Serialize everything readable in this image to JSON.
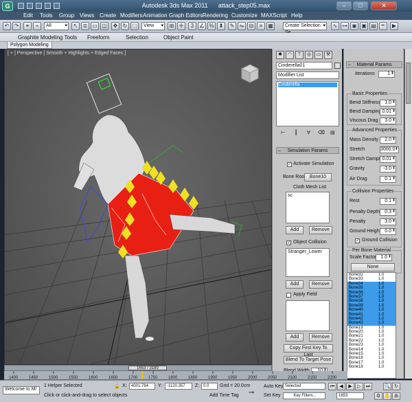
{
  "window": {
    "title_app": "Autodesk 3ds Max  2011",
    "title_file": "attack_step05.max",
    "minimize": "–",
    "maximize": "□",
    "close": "✕"
  },
  "menu": [
    "Edit",
    "Tools",
    "Group",
    "Views",
    "Create",
    "Modifiers",
    "Animation",
    "Graph Editors",
    "Rendering",
    "Customize",
    "MAXScript",
    "Help"
  ],
  "toolbar": {
    "selection_filter": "All",
    "reference_coord": "View",
    "named_selection": "Create Selection Se"
  },
  "ribbon": {
    "tabs": [
      "Graphite Modeling Tools",
      "Freeform",
      "Selection",
      "Object Paint"
    ],
    "panel_tab": "Polygon Modeling"
  },
  "viewport": {
    "label": "[ + ] Perspective  [ Smooth + Highlights + Edged Faces ]"
  },
  "command_panel": {
    "object_name": "Cinderella01",
    "modifier_list": "Modifier List",
    "stack_items": [
      "Cinderella"
    ],
    "simulation": {
      "header": "Simulation Params",
      "activate_label": "Activate Simulation",
      "activate_checked": true,
      "bone_root_label": "Bone Root",
      "bone_root_value": "Bone10",
      "cloth_mesh_label": "Cloth Mesh List",
      "cloth_mesh_items": [
        "sc"
      ],
      "add": "Add",
      "remove": "Remove",
      "object_collision_label": "Object Collision",
      "object_collision_checked": true,
      "collision_items": [
        "Stranger_Lower"
      ],
      "apply_field_label": "Apply Field",
      "apply_field_checked": false,
      "copy_first_key": "Copy First Key To Last",
      "blend_to_target": "Blend To Target Pose",
      "blend_width_label": "Blend Width",
      "blend_width_value": "10"
    }
  },
  "material_panel": {
    "header": "Material Params",
    "iterations_label": "Iterations",
    "iterations_value": "1",
    "basic_title": "Basic Properties",
    "basic": [
      {
        "label": "Bend Stiffness",
        "value": "1.0"
      },
      {
        "label": "Bend Damping",
        "value": "0.01"
      },
      {
        "label": "Viscous Drag",
        "value": "3.0"
      }
    ],
    "advanced_title": "Advanced Properties",
    "advanced": [
      {
        "label": "Mass Density",
        "value": "2.0"
      },
      {
        "label": "Stretch",
        "value": "3000.0"
      },
      {
        "label": "Stretch Damping",
        "value": "0.01"
      },
      {
        "label": "Gravity",
        "value": "-3.0"
      },
      {
        "label": "Air Drag",
        "value": "0.1"
      }
    ],
    "collision_title": "Collision Properties",
    "collision": [
      {
        "label": "Rest",
        "value": "0.1"
      },
      {
        "label": "Penalty Depth",
        "value": "0.3"
      },
      {
        "label": "Penalty",
        "value": "3.0"
      },
      {
        "label": "Ground Height",
        "value": "0.0"
      }
    ],
    "ground_collision_label": "Ground Collision",
    "ground_collision_checked": true,
    "per_bone_title": "Per Bone Material",
    "scale_factor_label": "Scale Factor",
    "scale_factor_value": "1.0",
    "none_button": "None",
    "bones": [
      {
        "name": "Bone32",
        "value": "1.0",
        "sel": false
      },
      {
        "name": "Bone33",
        "value": "1.0",
        "sel": false
      },
      {
        "name": "Bone34",
        "value": "1.0",
        "sel": true
      },
      {
        "name": "Bone35",
        "value": "1.0",
        "sel": true
      },
      {
        "name": "Bone36",
        "value": "1.0",
        "sel": true
      },
      {
        "name": "Bone37",
        "value": "1.0",
        "sel": true
      },
      {
        "name": "Bone38",
        "value": "1.0",
        "sel": true
      },
      {
        "name": "Bone39",
        "value": "1.0",
        "sel": true
      },
      {
        "name": "Bone40",
        "value": "1.0",
        "sel": true
      },
      {
        "name": "Bone41",
        "value": "1.0",
        "sel": true
      },
      {
        "name": "Bone42",
        "value": "1.0",
        "sel": true
      },
      {
        "name": "Bone43",
        "value": "1.0",
        "sel": true
      },
      {
        "name": "Bone19",
        "value": "1.0",
        "sel": false
      },
      {
        "name": "Bone20",
        "value": "1.0",
        "sel": false
      },
      {
        "name": "Bone21",
        "value": "1.0",
        "sel": false
      },
      {
        "name": "Bone22",
        "value": "1.0",
        "sel": false
      },
      {
        "name": "Bone23",
        "value": "1.0",
        "sel": false
      },
      {
        "name": "Bone14",
        "value": "1.0",
        "sel": false
      },
      {
        "name": "Bone15",
        "value": "1.0",
        "sel": false
      },
      {
        "name": "Bone16",
        "value": "1.0",
        "sel": false
      },
      {
        "name": "Bone17",
        "value": "1.0",
        "sel": false
      },
      {
        "name": "Bone18",
        "value": "1.0",
        "sel": false
      }
    ]
  },
  "timeline": {
    "frame_display": "1653 / 3180",
    "ticks": [
      "1400",
      "1450",
      "1500",
      "1550",
      "1600",
      "1650",
      "1700",
      "1750",
      "1800",
      "1850",
      "1900",
      "1950",
      "2000",
      "2050",
      "2100",
      "2150",
      "2200"
    ]
  },
  "status": {
    "maxscript_listener": "Welcome to M/",
    "selection_info": "1 Helper Selected",
    "prompt": "Click or click-and-drag to select objects",
    "x_label": "X:",
    "x_value": "4001.784",
    "y_label": "Y:",
    "y_value": "-1120.357",
    "z_label": "Z:",
    "z_value": "0.0",
    "grid": "Grid = 20.0cm",
    "add_time_tag": "Add Time Tag",
    "auto_key": "Auto Key",
    "set_key": "Set Key",
    "key_mode_select": "Selected",
    "key_filters": "Key Filters...",
    "current_frame": "1653"
  }
}
